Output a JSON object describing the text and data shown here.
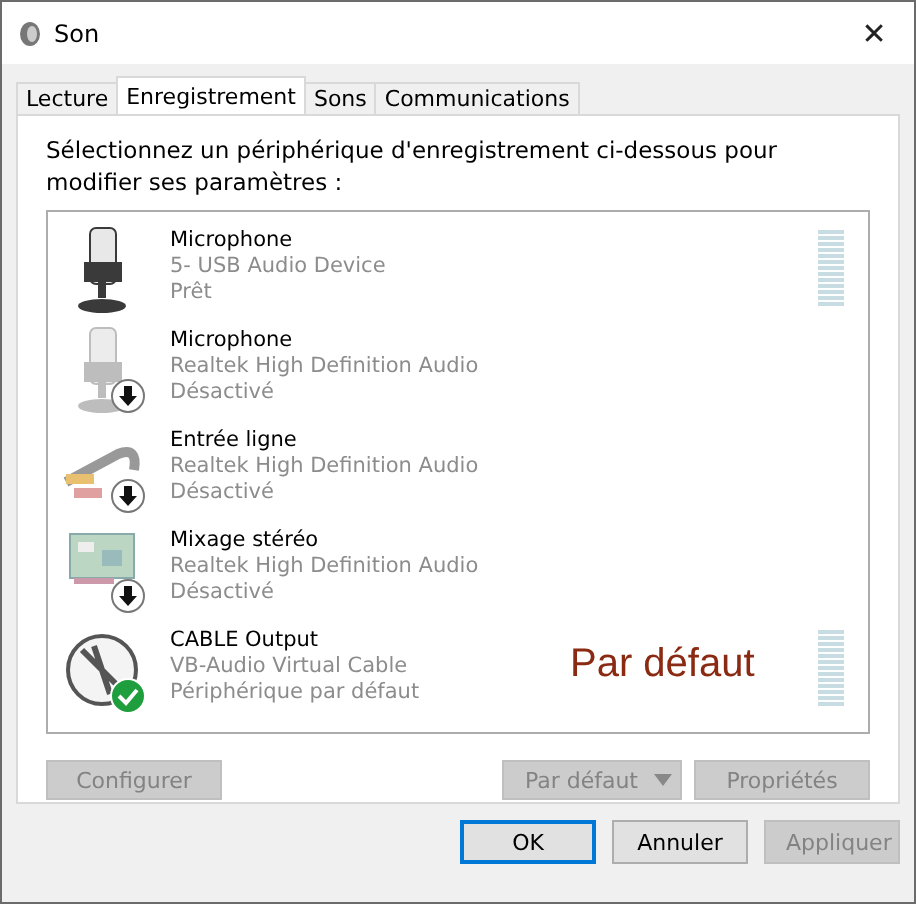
{
  "window": {
    "title": "Son",
    "close": "✕"
  },
  "tabs": [
    {
      "label": "Lecture",
      "selected": false
    },
    {
      "label": "Enregistrement",
      "selected": true
    },
    {
      "label": "Sons",
      "selected": false
    },
    {
      "label": "Communications",
      "selected": false
    }
  ],
  "instruction": "Sélectionnez un périphérique d'enregistrement ci-dessous pour modifier ses paramètres :",
  "devices": [
    {
      "kind": "mic",
      "name": "Microphone",
      "driver": "5- USB Audio Device",
      "status": "Prêt",
      "enabled": true,
      "default": false
    },
    {
      "kind": "mic",
      "name": "Microphone",
      "driver": "Realtek High Definition Audio",
      "status": "Désactivé",
      "enabled": false,
      "default": false
    },
    {
      "kind": "line",
      "name": "Entrée ligne",
      "driver": "Realtek High Definition Audio",
      "status": "Désactivé",
      "enabled": false,
      "default": false
    },
    {
      "kind": "card",
      "name": "Mixage stéréo",
      "driver": "Realtek High Definition Audio",
      "status": "Désactivé",
      "enabled": false,
      "default": false
    },
    {
      "kind": "cable",
      "name": "CABLE Output",
      "driver": "VB-Audio Virtual Cable",
      "status": "Périphérique par défaut",
      "enabled": true,
      "default": true,
      "annotation": "Par défaut"
    }
  ],
  "panel_buttons": [
    {
      "label": "Configurer",
      "disabled": true
    },
    {
      "label": "Par défaut",
      "disabled": true,
      "split": true
    },
    {
      "label": "Propriétés",
      "disabled": true
    }
  ],
  "dialog_buttons": [
    {
      "label": "OK",
      "disabled": false,
      "focused": true
    },
    {
      "label": "Annuler",
      "disabled": false,
      "focused": false
    },
    {
      "label": "Appliquer",
      "disabled": true,
      "focused": false
    }
  ]
}
